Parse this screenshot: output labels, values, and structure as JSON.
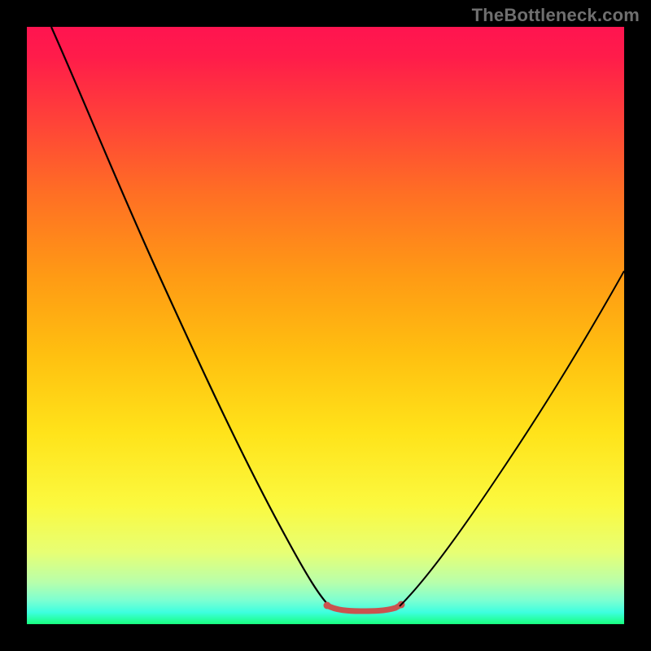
{
  "watermark": "TheBottleneck.com",
  "chart_data": {
    "type": "line",
    "title": "",
    "xlabel": "",
    "ylabel": "",
    "xlim": [
      0,
      100
    ],
    "ylim": [
      0,
      100
    ],
    "grid": false,
    "legend": false,
    "gradient_meaning": "background encodes value from red (high/bad) at top to green (low/good) at bottom",
    "series": [
      {
        "name": "curve-left",
        "stroke": "#000000",
        "x": [
          4,
          10,
          20,
          30,
          40,
          47,
          50,
          52
        ],
        "y": [
          100,
          86,
          66,
          47,
          27,
          10,
          4,
          2
        ]
      },
      {
        "name": "flat-bottom",
        "stroke": "#c9534f",
        "stroke_width_px": 5,
        "x": [
          50,
          52,
          54,
          56,
          58,
          60,
          62,
          63
        ],
        "y": [
          3,
          2,
          2,
          2,
          2,
          2,
          2,
          3
        ]
      },
      {
        "name": "curve-right",
        "stroke": "#000000",
        "x": [
          62,
          68,
          75,
          82,
          90,
          100
        ],
        "y": [
          3,
          10,
          20,
          31,
          44,
          60
        ]
      }
    ],
    "colors": {
      "top": "#ff1450",
      "mid": "#ffd015",
      "bottom": "#18ff7e",
      "watermark": "#6f6f6f",
      "flat_segment": "#c9534f"
    }
  }
}
